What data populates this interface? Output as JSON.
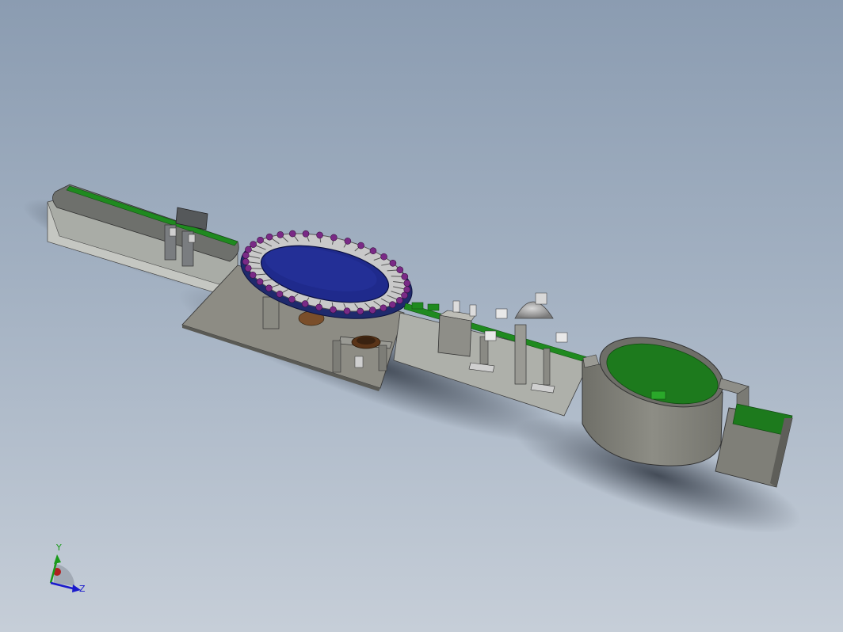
{
  "viewport": {
    "background_top": "#8b9cb1",
    "background_bottom": "#c6ced8"
  },
  "model": {
    "conveyor_belt_color": "#1f8a1f",
    "turntable_color": "#1f2a8c",
    "star_wheel_color": "#7a2a86",
    "frame_color": "#8c8c82",
    "hopper_color": "#1d7a1d"
  },
  "triad": {
    "y_label": "Y",
    "z_label": "Z",
    "y_color": "#1a9a1a",
    "z_color": "#1a1acc",
    "x_color": "#b02020"
  }
}
